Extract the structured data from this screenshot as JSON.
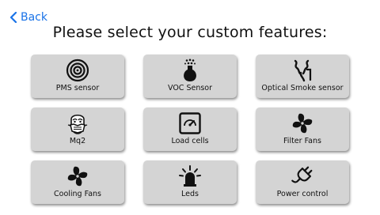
{
  "nav": {
    "back_label": "Back"
  },
  "page": {
    "title": "Please select your custom features:"
  },
  "features": [
    {
      "label": "PMS sensor",
      "icon": "target-rings-icon"
    },
    {
      "label": "VOC Sensor",
      "icon": "flask-icon"
    },
    {
      "label": "Optical Smoke sensor",
      "icon": "smoke-icon"
    },
    {
      "label": "Mq2",
      "icon": "gas-mask-icon"
    },
    {
      "label": "Load cells",
      "icon": "gauge-icon"
    },
    {
      "label": "Filter Fans",
      "icon": "fan-icon"
    },
    {
      "label": "Cooling Fans",
      "icon": "fan-icon"
    },
    {
      "label": "Leds",
      "icon": "led-light-icon"
    },
    {
      "label": "Power control",
      "icon": "plug-icon"
    }
  ]
}
